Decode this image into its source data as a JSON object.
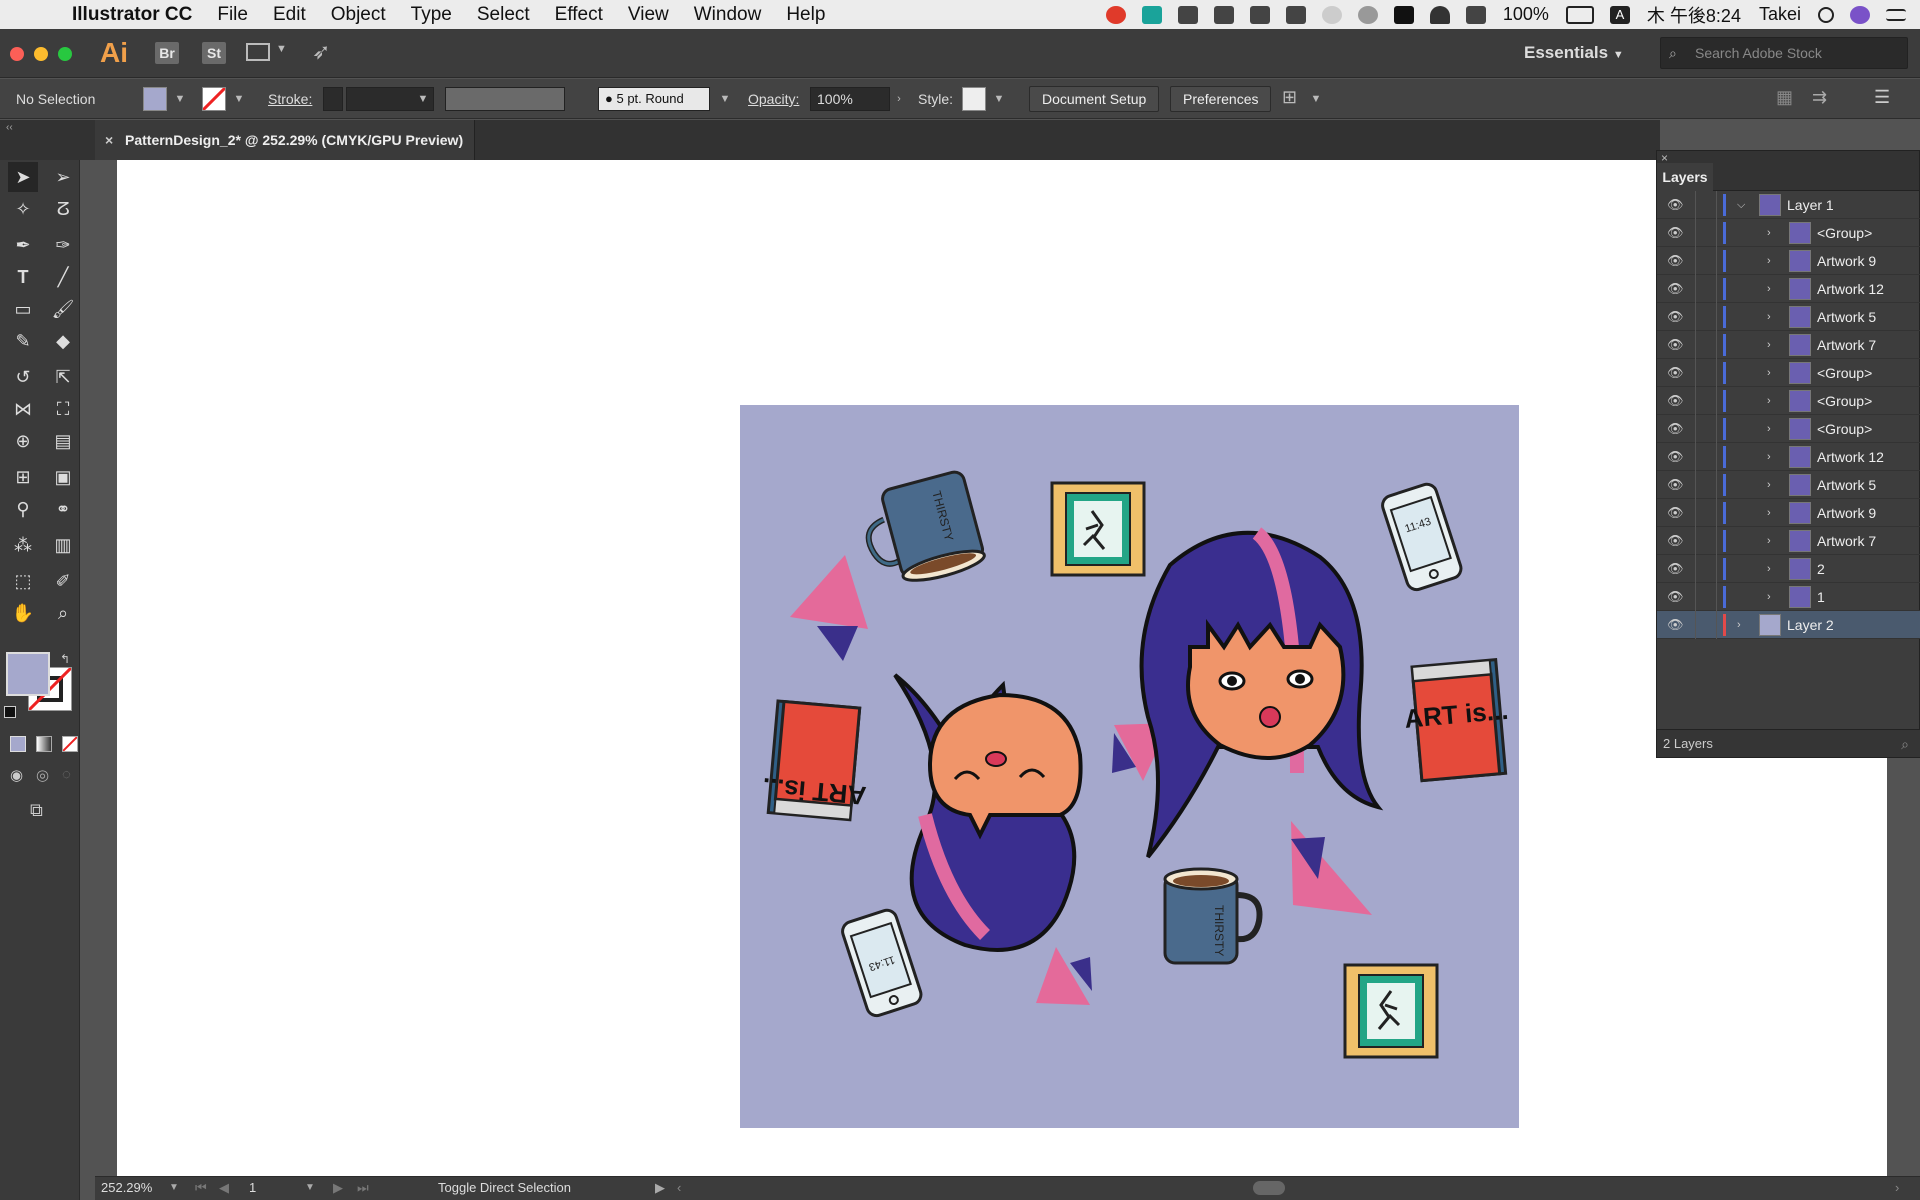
{
  "menubar": {
    "app_name": "Illustrator CC",
    "items": [
      "File",
      "Edit",
      "Object",
      "Type",
      "Select",
      "Effect",
      "View",
      "Window",
      "Help"
    ],
    "battery": "100%",
    "clock": "木 午後8:24",
    "user": "Takei"
  },
  "appbar": {
    "logo": "Ai",
    "bridge": "Br",
    "stock": "St",
    "workspace": "Essentials",
    "search_placeholder": "Search Adobe Stock"
  },
  "controlbar": {
    "selection": "No Selection",
    "fill_color": "#a5a8cc",
    "stroke_label": "Stroke:",
    "brush": "5 pt. Round",
    "opacity_label": "Opacity:",
    "opacity_value": "100%",
    "style_label": "Style:",
    "document_setup": "Document Setup",
    "preferences": "Preferences"
  },
  "document": {
    "tab_title": "PatternDesign_2* @ 252.29% (CMYK/GPU Preview)",
    "artboard_color": "#a5a8cc"
  },
  "artwork_text": {
    "mug": "THIRSTY",
    "book": "ART is...",
    "phone": "11:43"
  },
  "layers": {
    "title": "Layers",
    "rows": [
      {
        "name": "Layer 1",
        "level": 0,
        "bar": "#4a6bd8",
        "expanded": true
      },
      {
        "name": "<Group>",
        "level": 1,
        "bar": "#4a6bd8"
      },
      {
        "name": "Artwork 9",
        "level": 1,
        "bar": "#4a6bd8"
      },
      {
        "name": "Artwork 12",
        "level": 1,
        "bar": "#4a6bd8"
      },
      {
        "name": "Artwork 5",
        "level": 1,
        "bar": "#4a6bd8"
      },
      {
        "name": "Artwork 7",
        "level": 1,
        "bar": "#4a6bd8"
      },
      {
        "name": "<Group>",
        "level": 1,
        "bar": "#4a6bd8"
      },
      {
        "name": "<Group>",
        "level": 1,
        "bar": "#4a6bd8"
      },
      {
        "name": "<Group>",
        "level": 1,
        "bar": "#4a6bd8"
      },
      {
        "name": "Artwork 12",
        "level": 1,
        "bar": "#4a6bd8"
      },
      {
        "name": "Artwork 5",
        "level": 1,
        "bar": "#4a6bd8"
      },
      {
        "name": "Artwork 9",
        "level": 1,
        "bar": "#4a6bd8"
      },
      {
        "name": "Artwork 7",
        "level": 1,
        "bar": "#4a6bd8"
      },
      {
        "name": "2",
        "level": 1,
        "bar": "#4a6bd8"
      },
      {
        "name": "1",
        "level": 1,
        "bar": "#4a6bd8"
      },
      {
        "name": "Layer 2",
        "level": 0,
        "bar": "#e24a4a",
        "selected": true
      }
    ],
    "footer": "2 Layers"
  },
  "status": {
    "zoom": "252.29%",
    "artboard": "1",
    "message": "Toggle Direct Selection"
  }
}
